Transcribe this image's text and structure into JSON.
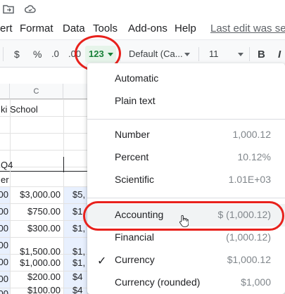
{
  "menubar": {
    "items": [
      "ert",
      "Format",
      "Data",
      "Tools",
      "Add-ons",
      "Help"
    ],
    "last_edit": "Last edit was sec"
  },
  "toolbar": {
    "currency": "$",
    "percent": "%",
    "dec_decrease": ".0",
    "dec_increase": ".00",
    "number_format": "123",
    "font": "Default (Ca...",
    "font_size": "11",
    "bold": "B"
  },
  "sheet": {
    "column_c": "C",
    "title_fragment": "ki School",
    "quarter_label": "Q4",
    "row_label_fragment": "er",
    "col_a_values": [
      "00",
      "00",
      "00",
      "00",
      "00",
      "00",
      "00"
    ],
    "col_c_values": [
      "$3,000.00",
      "$750.00",
      "$300.00",
      "",
      "$1,500.00",
      "$1,000.00",
      "$200.00",
      "$100.00"
    ],
    "col_d_values": [
      "$5,",
      "$1,",
      "$1,",
      "",
      "$1,",
      "$1,",
      "$4",
      "$4"
    ]
  },
  "dropdown": {
    "group1": [
      {
        "label": "Automatic",
        "value": ""
      },
      {
        "label": "Plain text",
        "value": ""
      }
    ],
    "group2": [
      {
        "label": "Number",
        "value": "1,000.12"
      },
      {
        "label": "Percent",
        "value": "10.12%"
      },
      {
        "label": "Scientific",
        "value": "1.01E+03"
      }
    ],
    "group3": [
      {
        "label": "Accounting",
        "value": "$ (1,000.12)"
      },
      {
        "label": "Financial",
        "value": "(1,000.12)"
      },
      {
        "label": "Currency",
        "value": "$1,000.12"
      },
      {
        "label": "Currency (rounded)",
        "value": "$1,000"
      }
    ],
    "checked": "Currency",
    "hovered": "Accounting",
    "check_glyph": "✓"
  },
  "colors": {
    "annotation_red": "#e8211c",
    "number_format_green": "#188038",
    "selection_blue": "#e8f0fe"
  }
}
